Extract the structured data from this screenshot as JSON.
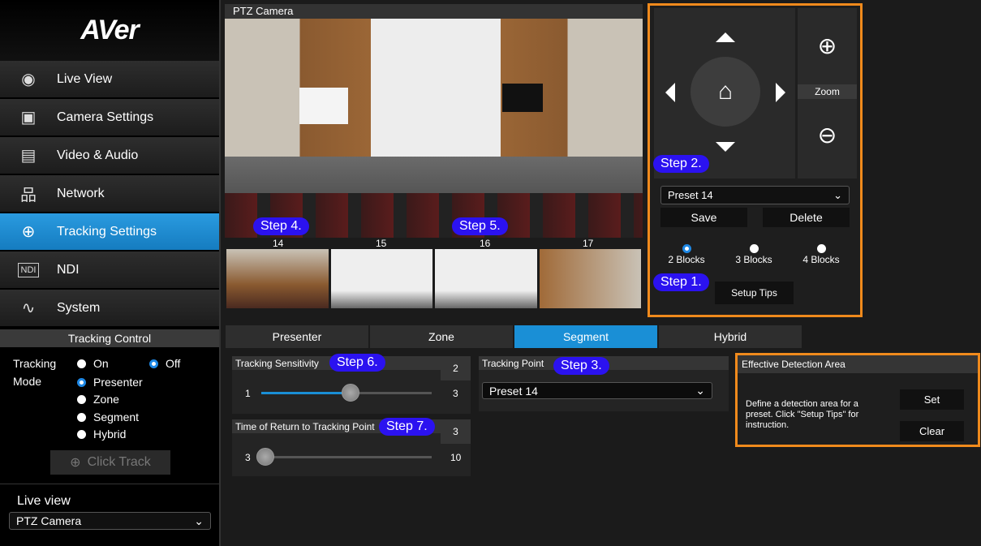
{
  "sidebar": {
    "logo": "AVer",
    "items": [
      {
        "label": "Live View",
        "icon": "eye-icon"
      },
      {
        "label": "Camera Settings",
        "icon": "image-icon"
      },
      {
        "label": "Video & Audio",
        "icon": "video-audio-icon"
      },
      {
        "label": "Network",
        "icon": "network-icon"
      },
      {
        "label": "Tracking Settings",
        "icon": "crosshair-icon",
        "active": true
      },
      {
        "label": "NDI",
        "icon": "ndi-icon"
      },
      {
        "label": "System",
        "icon": "pulse-icon"
      }
    ]
  },
  "tracking_control": {
    "title": "Tracking Control",
    "tracking_label": "Tracking",
    "on": "On",
    "off": "Off",
    "tracking_value": "Off",
    "mode_label": "Mode",
    "modes": [
      "Presenter",
      "Zone",
      "Segment",
      "Hybrid"
    ],
    "mode_value": "Presenter",
    "click_track": "Click Track"
  },
  "live_view": {
    "label": "Live view",
    "value": "PTZ Camera"
  },
  "camera": {
    "title": "PTZ Camera",
    "segments": [
      "14",
      "15",
      "16",
      "17"
    ]
  },
  "ptz": {
    "zoom_label": "Zoom",
    "preset_value": "Preset 14",
    "save": "Save",
    "delete": "Delete",
    "blocks": [
      "2 Blocks",
      "3 Blocks",
      "4 Blocks"
    ],
    "blocks_value": "2 Blocks",
    "setup_tips": "Setup Tips"
  },
  "tabs": [
    "Presenter",
    "Zone",
    "Segment",
    "Hybrid"
  ],
  "active_tab": "Segment",
  "sensitivity": {
    "label": "Tracking Sensitivity",
    "value": "2",
    "min": "1",
    "max": "3"
  },
  "return_time": {
    "label": "Time of Return to Tracking Point",
    "value": "3",
    "min": "3",
    "max": "10"
  },
  "tracking_point": {
    "label": "Tracking Point",
    "value": "Preset 14"
  },
  "detection": {
    "title": "Effective Detection Area",
    "desc": "Define a detection area for a preset. Click \"Setup Tips\" for instruction.",
    "set": "Set",
    "clear": "Clear"
  },
  "steps": {
    "s1": "Step 1.",
    "s2": "Step 2.",
    "s3": "Step 3.",
    "s4": "Step 4.",
    "s5": "Step 5.",
    "s6": "Step 6.",
    "s7": "Step 7."
  },
  "colors": {
    "accent": "#1a8fd6",
    "highlight": "#f08a1c",
    "step": "#2b12f0"
  }
}
